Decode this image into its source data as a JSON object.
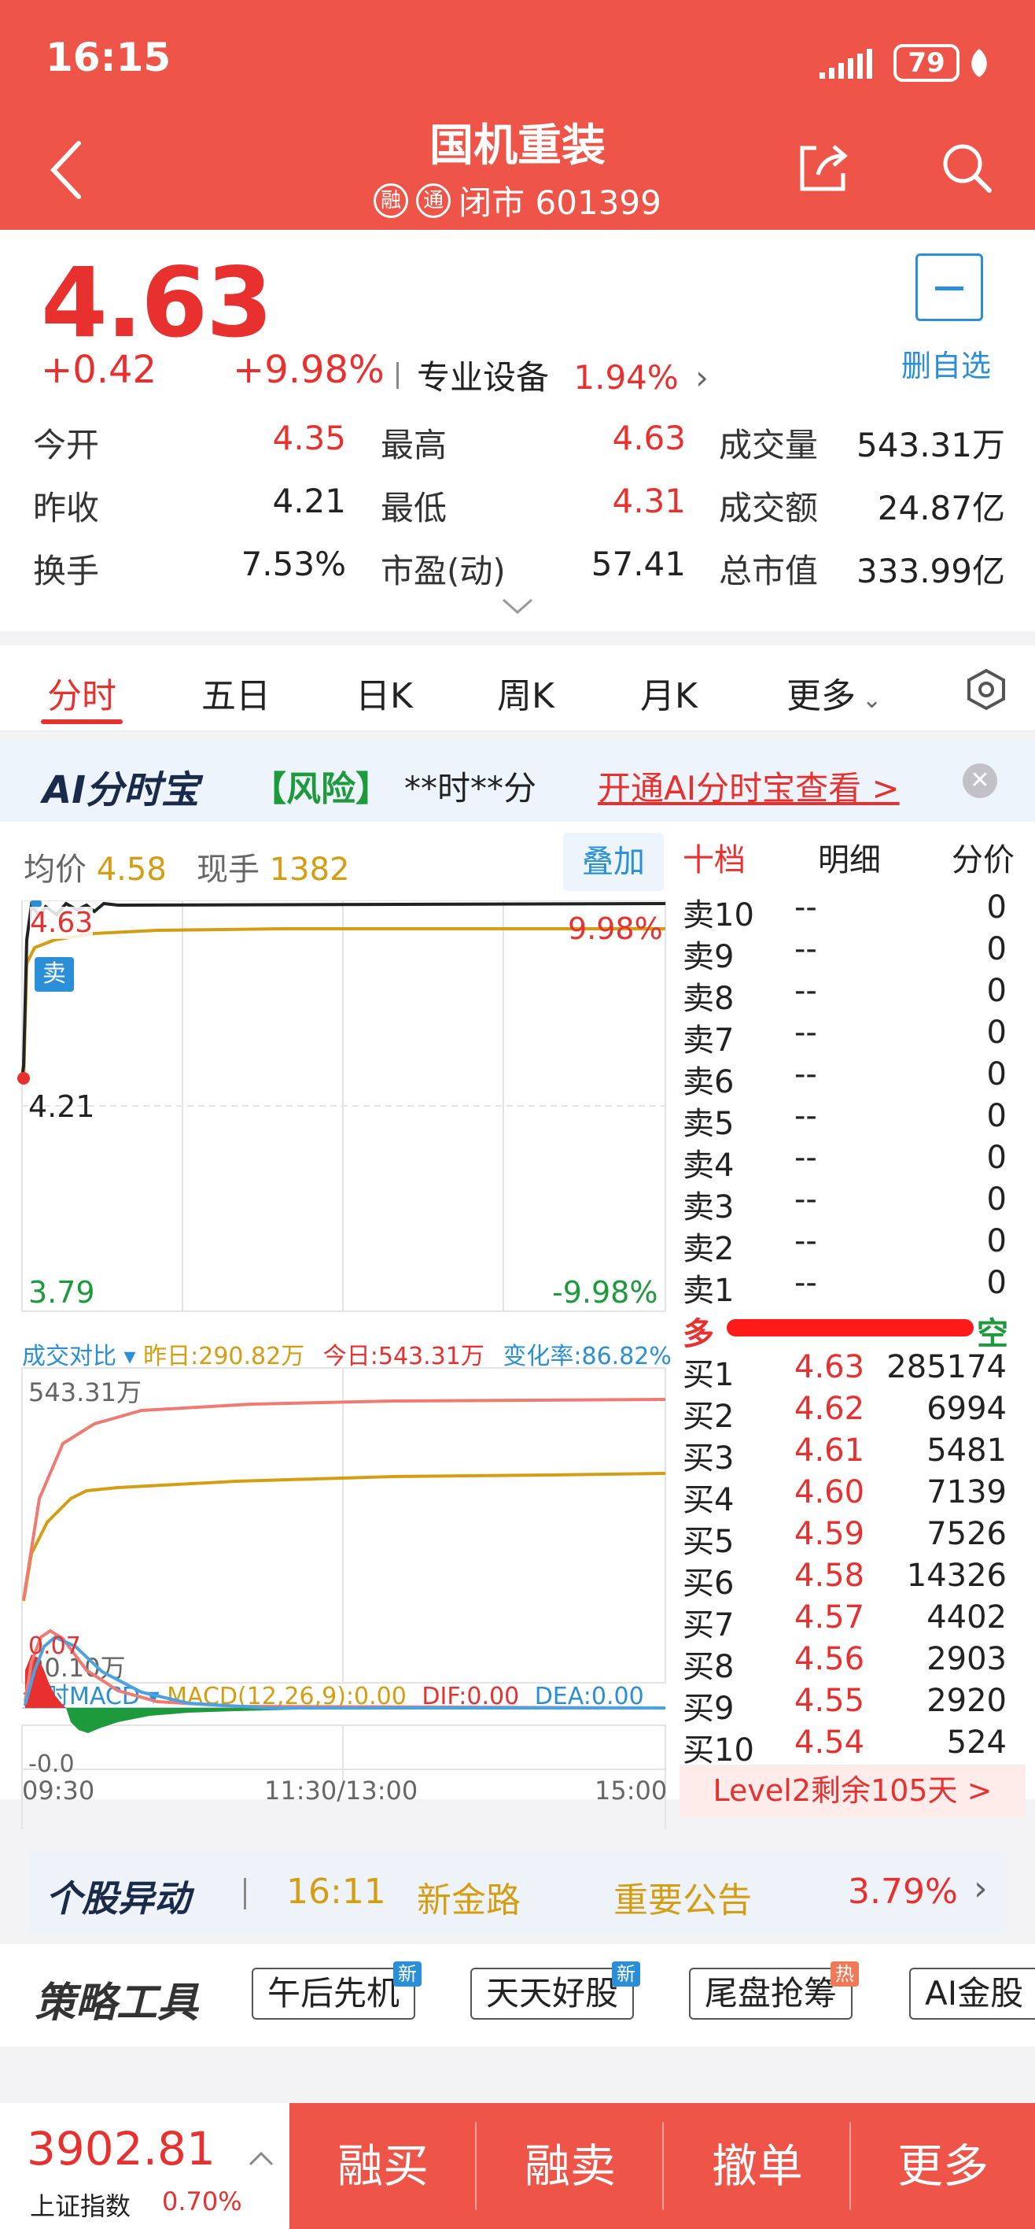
{
  "status_bar": {
    "time": "16:15",
    "battery": "79"
  },
  "header": {
    "title": "国机重装",
    "tag1": "融",
    "tag2": "通",
    "status": "闭市 601399"
  },
  "quote": {
    "price": "4.63",
    "change": "+0.42",
    "change_pct": "+9.98%",
    "sector": "专业设备",
    "sector_pct": "1.94%",
    "watch_label": "删自选",
    "stats": [
      {
        "label": "今开",
        "value": "4.35",
        "color": "red"
      },
      {
        "label": "最高",
        "value": "4.63",
        "color": "red"
      },
      {
        "label": "成交量",
        "value": "543.31万",
        "color": "black"
      },
      {
        "label": "昨收",
        "value": "4.21",
        "color": "black"
      },
      {
        "label": "最低",
        "value": "4.31",
        "color": "red"
      },
      {
        "label": "成交额",
        "value": "24.87亿",
        "color": "black"
      },
      {
        "label": "换手",
        "value": "7.53%",
        "color": "black"
      },
      {
        "label": "市盈(动)",
        "value": "57.41",
        "color": "black"
      },
      {
        "label": "总市值",
        "value": "333.99亿",
        "color": "black"
      }
    ]
  },
  "tabs": [
    "分时",
    "五日",
    "日K",
    "周K",
    "月K",
    "更多"
  ],
  "ai_banner": {
    "logo": "AI分时宝",
    "risk": "【风险】",
    "time_text": "**时**分",
    "cta": "开通AI分时宝查看 >"
  },
  "chart": {
    "avg_label": "均价",
    "avg_value": "4.58",
    "cur_label": "现手",
    "cur_value": "1382",
    "overlay_btn": "叠加",
    "price_top": "4.63",
    "pct_top": "9.98%",
    "price_mid": "4.21",
    "price_bot": "3.79",
    "pct_bot": "-9.98%",
    "sell_marker": "卖",
    "vol_title": "成交对比",
    "vol_yesterday": "昨日:290.82万",
    "vol_today": "今日:543.31万",
    "vol_rate": "变化率:86.82%",
    "vol_top": "543.31万",
    "vol_bot": "20.10万",
    "macd_title": "分时MACD",
    "macd_params": "MACD(12,26,9):0.00",
    "dif": "DIF:0.00",
    "dea": "DEA:0.00",
    "macd_top": "0.07",
    "macd_bot": "-0.0",
    "time_start": "09:30",
    "time_mid": "11:30/13:00",
    "time_end": "15:00"
  },
  "order_book": {
    "tabs": [
      "十档",
      "明细",
      "分价"
    ],
    "sells": [
      {
        "label": "卖10",
        "price": "--",
        "vol": "0"
      },
      {
        "label": "卖9",
        "price": "--",
        "vol": "0"
      },
      {
        "label": "卖8",
        "price": "--",
        "vol": "0"
      },
      {
        "label": "卖7",
        "price": "--",
        "vol": "0"
      },
      {
        "label": "卖6",
        "price": "--",
        "vol": "0"
      },
      {
        "label": "卖5",
        "price": "--",
        "vol": "0"
      },
      {
        "label": "卖4",
        "price": "--",
        "vol": "0"
      },
      {
        "label": "卖3",
        "price": "--",
        "vol": "0"
      },
      {
        "label": "卖2",
        "price": "--",
        "vol": "0"
      },
      {
        "label": "卖1",
        "price": "--",
        "vol": "0"
      }
    ],
    "bull_label": "多",
    "bear_label": "空",
    "buys": [
      {
        "label": "买1",
        "price": "4.63",
        "vol": "285174"
      },
      {
        "label": "买2",
        "price": "4.62",
        "vol": "6994"
      },
      {
        "label": "买3",
        "price": "4.61",
        "vol": "5481"
      },
      {
        "label": "买4",
        "price": "4.60",
        "vol": "7139"
      },
      {
        "label": "买5",
        "price": "4.59",
        "vol": "7526"
      },
      {
        "label": "买6",
        "price": "4.58",
        "vol": "14326"
      },
      {
        "label": "买7",
        "price": "4.57",
        "vol": "4402"
      },
      {
        "label": "买8",
        "price": "4.56",
        "vol": "2903"
      },
      {
        "label": "买9",
        "price": "4.55",
        "vol": "2920"
      },
      {
        "label": "买10",
        "price": "4.54",
        "vol": "524"
      }
    ],
    "level2": "Level2剩余105天 >"
  },
  "movement": {
    "logo": "个股异动",
    "time": "16:11",
    "name": "新金路",
    "type": "重要公告",
    "pct": "3.79%"
  },
  "strategy": {
    "logo": "策略工具",
    "chips": [
      {
        "label": "午后先机",
        "badge": "新"
      },
      {
        "label": "天天好股",
        "badge": "新"
      },
      {
        "label": "尾盘抢筹",
        "badge": "热"
      },
      {
        "label": "AI金股",
        "badge": ""
      }
    ]
  },
  "bottom": {
    "index_value": "3902.81",
    "index_name": "上证指数",
    "index_pct": "0.70%",
    "buttons": [
      "融买",
      "融卖",
      "撤单",
      "更多"
    ]
  },
  "colors": {
    "header": "#ee5548",
    "up": "#e8312f",
    "down": "#1c9a3c",
    "avg": "#d59d12",
    "accent": "#2a8fd6"
  }
}
